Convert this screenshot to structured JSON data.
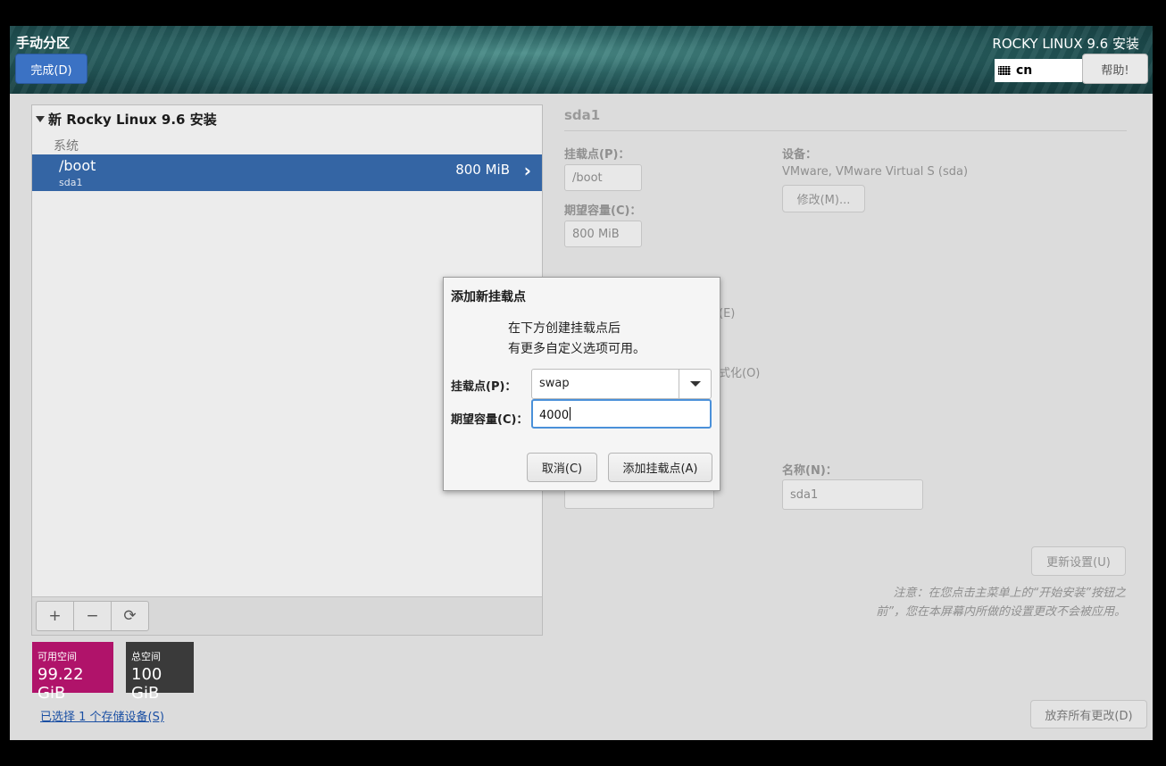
{
  "header": {
    "spoke_title": "手动分区",
    "done_label": "完成(D)",
    "distro_title": "ROCKY LINUX 9.6 安装",
    "keyboard_layout": "cn",
    "help_label": "帮助!"
  },
  "left": {
    "install_title": "新 Rocky Linux 9.6 安装",
    "system_label": "系统",
    "partitions": [
      {
        "mount": "/boot",
        "device": "sda1",
        "size": "800 MiB"
      }
    ],
    "toolbar": {
      "add": "+",
      "remove": "−",
      "refresh": "⟳"
    },
    "available_label": "可用空间",
    "available_value": "99.22 GiB",
    "total_label": "总空间",
    "total_value": "100 GiB",
    "storage_link": "已选择 1 个存储设备(S)"
  },
  "right": {
    "title": "sda1",
    "mount_label": "挂载点(P)：",
    "mount_value": "/boot",
    "capacity_label": "期望容量(C)：",
    "capacity_value": "800 MiB",
    "device_label": "设备：",
    "device_value": "VMware, VMware Virtual S (sda)",
    "modify_label": "修改(M)...",
    "partial_e": "(E)",
    "partial_o": "式化(O)",
    "name_label": "名称(N)：",
    "name_value": "sda1",
    "update_label": "更新设置(U)",
    "note": "注意：在您点击主菜单上的“开始安装”按钮之前”，您在本屏幕内所做的设置更改不会被应用。",
    "discard_label": "放弃所有更改(D)"
  },
  "dialog": {
    "title": "添加新挂载点",
    "desc_line1": "在下方创建挂载点后",
    "desc_line2": "有更多自定义选项可用。",
    "mount_label": "挂载点(P)：",
    "mount_value": "swap",
    "capacity_label": "期望容量(C)：",
    "capacity_value": "4000",
    "cancel_label": "取消(C)",
    "add_label": "添加挂载点(A)"
  }
}
